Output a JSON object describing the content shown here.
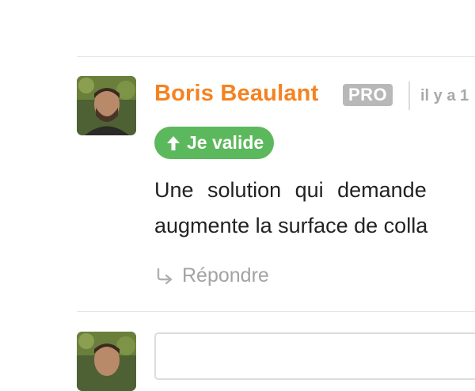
{
  "comment": {
    "author": "Boris Beaulant",
    "badge": "PRO",
    "timestamp": "il y a 1",
    "vote_label": "Je valide",
    "body_lines": [
      "Une solution qui demande",
      "augmente la surface de colla"
    ],
    "reply_label": "Répondre"
  },
  "reply_form": {
    "placeholder": ""
  },
  "colors": {
    "author": "#f58220",
    "badge_bg": "#b8b8b8",
    "vote_bg": "#5cb85c",
    "muted": "#a3a3a3"
  },
  "icons": {
    "vote": "arrow-up-icon",
    "reply": "reply-arrow-icon"
  }
}
